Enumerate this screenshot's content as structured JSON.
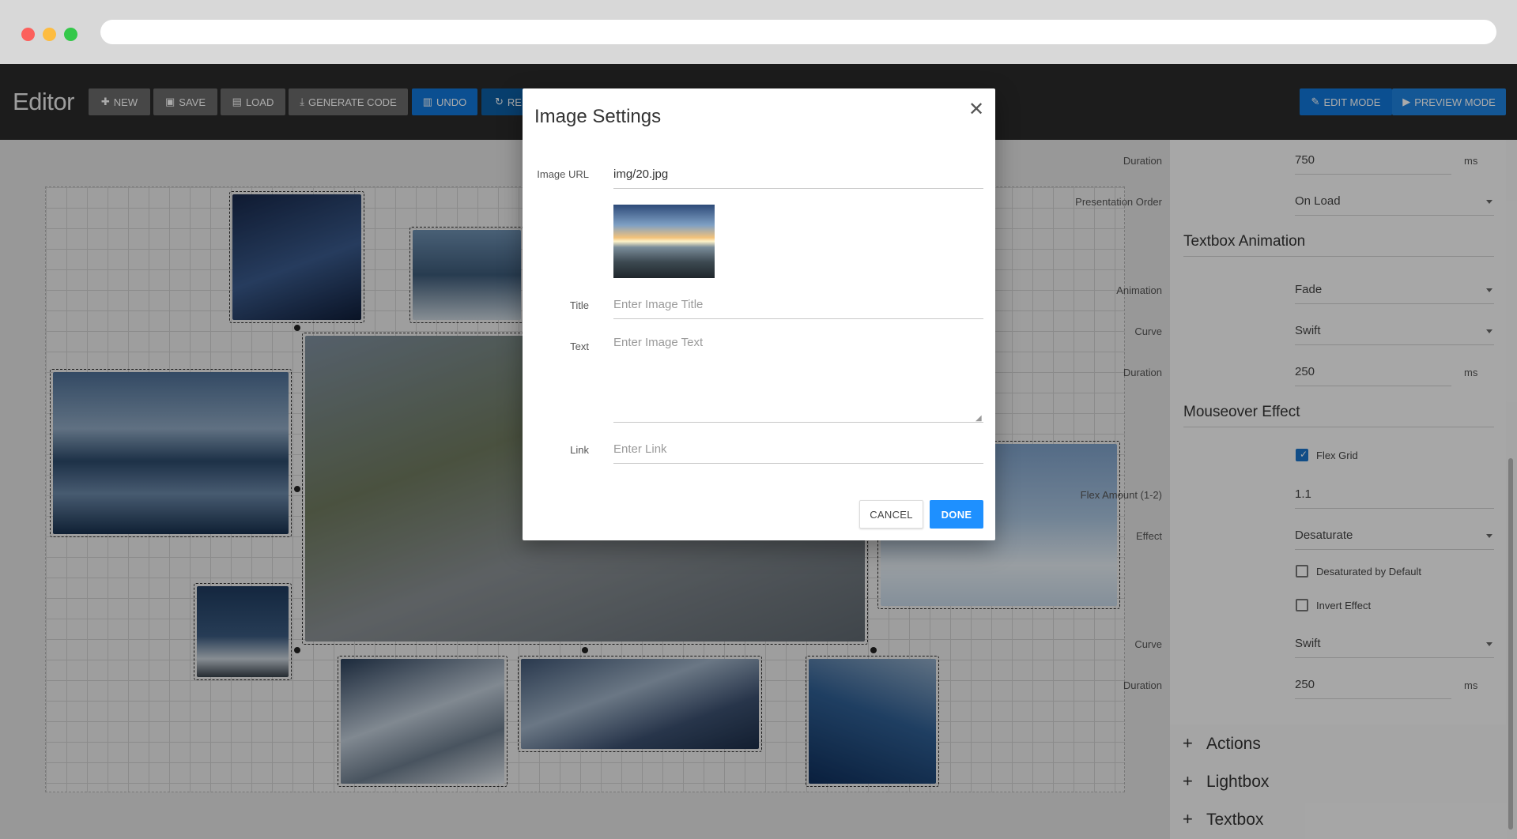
{
  "toolbar": {
    "app_title": "Editor",
    "buttons": [
      {
        "label": "NEW",
        "icon": "plus-icon"
      },
      {
        "label": "SAVE",
        "icon": "floppy-icon"
      },
      {
        "label": "LOAD",
        "icon": "folder-icon"
      },
      {
        "label": "GENERATE CODE",
        "icon": "download-icon"
      },
      {
        "label": "UNDO",
        "icon": "trash-icon"
      },
      {
        "label": "RE",
        "icon": "redo-icon"
      }
    ],
    "modes": [
      {
        "label": "EDIT MODE",
        "icon": "edit-icon"
      },
      {
        "label": "PREVIEW MODE",
        "icon": "play-icon"
      }
    ]
  },
  "panel": {
    "top_fields": [
      {
        "label": "Duration",
        "value": "750",
        "unit": "ms"
      },
      {
        "label": "Presentation Order",
        "value": "On Load"
      }
    ],
    "textbox_animation": {
      "heading": "Textbox Animation",
      "fields": [
        {
          "label": "Animation",
          "value": "Fade"
        },
        {
          "label": "Curve",
          "value": "Swift"
        },
        {
          "label": "Duration",
          "value": "250",
          "unit": "ms"
        }
      ]
    },
    "mouseover_effect": {
      "heading": "Mouseover Effect",
      "flex_grid": {
        "label": "Flex Grid",
        "checked": true
      },
      "flex_amount": {
        "label": "Flex Amount (1-2)",
        "value": "1.1"
      },
      "effect": {
        "label": "Effect",
        "value": "Desaturate"
      },
      "desaturated_default": {
        "label": "Desaturated by Default",
        "checked": false
      },
      "invert_effect": {
        "label": "Invert Effect",
        "checked": false
      },
      "curve": {
        "label": "Curve",
        "value": "Swift"
      },
      "duration": {
        "label": "Duration",
        "value": "250",
        "unit": "ms"
      }
    },
    "accordions": [
      "Actions",
      "Lightbox",
      "Textbox"
    ]
  },
  "modal": {
    "title": "Image Settings",
    "url_label": "Image URL",
    "url_value": "img/20.jpg",
    "title_label": "Title",
    "title_placeholder": "Enter Image Title",
    "text_label": "Text",
    "text_placeholder": "Enter Image Text",
    "link_label": "Link",
    "link_placeholder": "Enter Link",
    "cancel_label": "CANCEL",
    "done_label": "DONE"
  },
  "colors": {
    "toolbar_bg": "#2b2b2b",
    "primary_blue": "#1177d9",
    "done_blue": "#1e90ff",
    "checkbox_blue": "#1a73c9"
  }
}
